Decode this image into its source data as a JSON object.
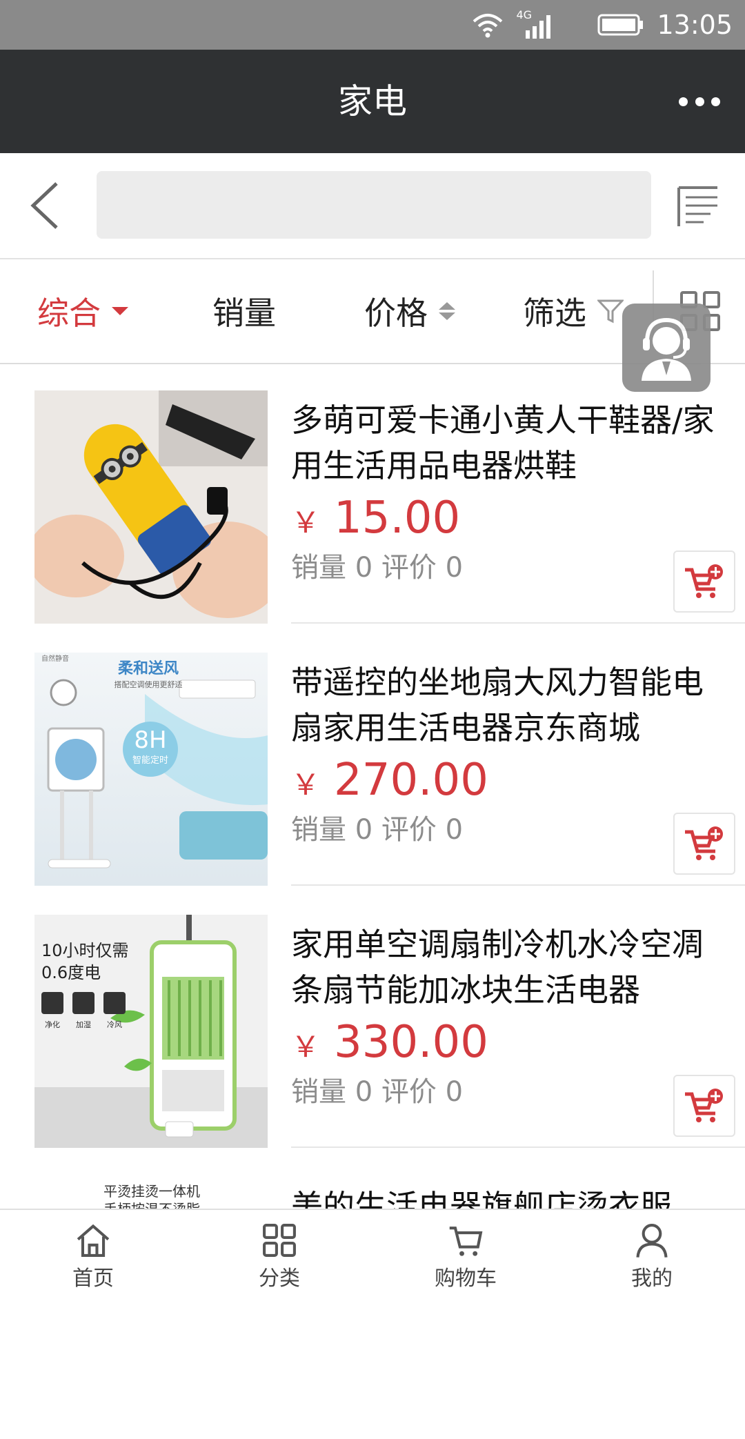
{
  "status_bar": {
    "time": "13:05",
    "network": "4G"
  },
  "header": {
    "title": "家电"
  },
  "search": {
    "placeholder": ""
  },
  "filters": {
    "comprehensive": "综合",
    "sales": "销量",
    "price": "价格",
    "filter": "筛选"
  },
  "products": [
    {
      "name": "多萌可爱卡通小黄人干鞋器/家用生活用品电器烘鞋",
      "currency": "￥",
      "price": "15.00",
      "stats": "销量 0  评价 0"
    },
    {
      "name": "带遥控的坐地扇大风力智能电扇家用生活电器京东商城",
      "currency": "￥",
      "price": "270.00",
      "stats": "销量 0  评价 0"
    },
    {
      "name": "家用单空调扇制冷机水冷空凋条扇节能加冰块生活电器",
      "currency": "￥",
      "price": "330.00",
      "stats": "销量 0  评价 0"
    },
    {
      "name": "美的生活电器旗舰店烫衣服",
      "currency": "",
      "price": "",
      "stats": ""
    }
  ],
  "product_images": {
    "p1": {
      "kind": "photo"
    },
    "p2": {
      "badge_title": "柔和送风",
      "badge_sub": "搭配空调使用更舒适",
      "timer": "8H",
      "timer_sub": "智能定时",
      "corner": "自然静音"
    },
    "p3": {
      "line1": "10小时仅需",
      "line2": "0.6度电",
      "icons": [
        "净化",
        "加湿",
        "冷风"
      ]
    },
    "p4": {
      "line1": "平烫挂烫一体机",
      "line2": "手柄按温不烫脂"
    }
  },
  "tabbar": [
    "首页",
    "分类",
    "购物车",
    "我的"
  ],
  "colors": {
    "accent": "#d33a3e",
    "topbar": "#2f3133",
    "statusbar": "#8a8a8a"
  }
}
